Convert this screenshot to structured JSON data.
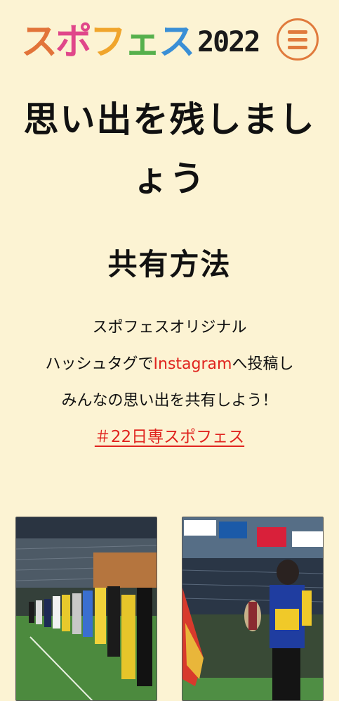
{
  "header": {
    "logo_chars": [
      "ス",
      "ポ",
      "フ",
      "ェ",
      "ス"
    ],
    "logo_colors": [
      "#e2743a",
      "#e0478a",
      "#f0a52c",
      "#56b04c",
      "#3a8fd6"
    ],
    "logo_year": "2022",
    "menu_icon": "hamburger-icon",
    "accent": "#e07a3c"
  },
  "main": {
    "title": "思い出を残しましょう",
    "section_title": "共有方法",
    "lines": {
      "line1": "スポフェスオリジナル",
      "line2_before": "ハッシュタグで",
      "line2_link": "Instagram",
      "line2_after": "へ投稿し",
      "line3": "みんなの思い出を共有しよう！"
    },
    "hashtag": "＃22日専スポフェス"
  },
  "gallery": {
    "photos": [
      "stadium-lineup-photo",
      "trophy-athlete-photo"
    ]
  }
}
